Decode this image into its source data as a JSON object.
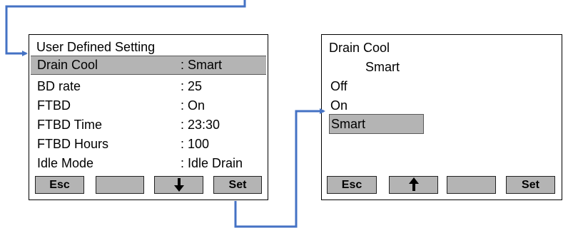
{
  "left_screen": {
    "title": "User Defined Setting",
    "rows": [
      {
        "label": "Drain Cool",
        "value": ": Smart",
        "selected": true
      },
      {
        "label": "BD rate",
        "value": ": 25",
        "selected": false
      },
      {
        "label": "FTBD",
        "value": ": On",
        "selected": false
      },
      {
        "label": "FTBD Time",
        "value": ": 23:30",
        "selected": false
      },
      {
        "label": "FTBD Hours",
        "value": ": 100",
        "selected": false
      },
      {
        "label": "Idle Mode",
        "value": ": Idle Drain",
        "selected": false
      }
    ],
    "softkeys": [
      {
        "label": "Esc",
        "icon": ""
      },
      {
        "label": "",
        "icon": ""
      },
      {
        "label": "",
        "icon": "arrow-down-icon"
      },
      {
        "label": "Set",
        "icon": ""
      }
    ]
  },
  "right_screen": {
    "title": "Drain Cool",
    "current_value": "Smart",
    "options": [
      {
        "label": "Off",
        "selected": false
      },
      {
        "label": "On",
        "selected": false
      },
      {
        "label": "Smart",
        "selected": true
      }
    ],
    "softkeys": [
      {
        "label": "Esc",
        "icon": ""
      },
      {
        "label": "",
        "icon": "arrow-up-icon"
      },
      {
        "label": "",
        "icon": ""
      },
      {
        "label": "Set",
        "icon": ""
      }
    ]
  },
  "colors": {
    "selection": "#b4b4b4",
    "connector": "#4472c4"
  }
}
